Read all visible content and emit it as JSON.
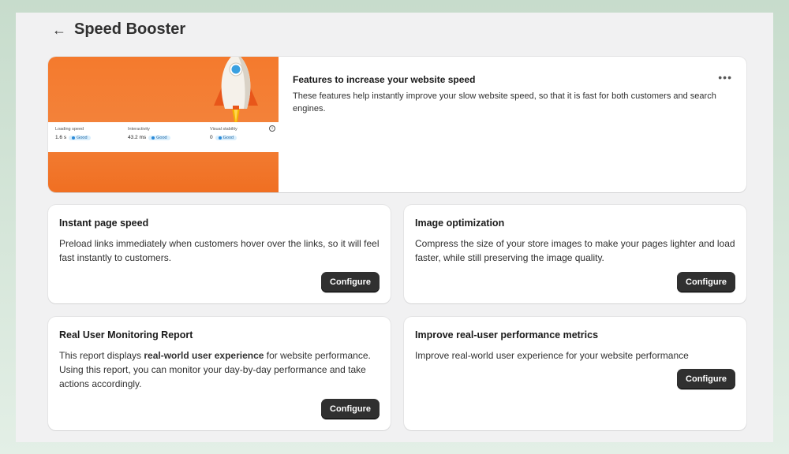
{
  "header": {
    "title": "Speed Booster",
    "back_icon": "←"
  },
  "hero": {
    "title": "Features to increase your website speed",
    "description": "These features help instantly improve your slow website speed, so that it is fast for both customers and search engines.",
    "more_label": "•••",
    "metrics": [
      {
        "label": "Loading speed",
        "value": "1.6 s",
        "status": "Good"
      },
      {
        "label": "Interactivity",
        "value": "43.2 ms",
        "status": "Good"
      },
      {
        "label": "Visual stability",
        "value": "0",
        "status": "Good"
      }
    ],
    "info_icon": "i",
    "colors": {
      "banner": "#f47a2d",
      "rocket_body": "#f5f1ea",
      "window": "#3aa0e0"
    }
  },
  "features": [
    {
      "title": "Instant page speed",
      "description": "Preload links immediately when customers hover over the links, so it will feel fast instantly to customers.",
      "button": "Configure"
    },
    {
      "title": "Image optimization",
      "description": "Compress the size of your store images to make your pages lighter and load faster, while still preserving the image quality.",
      "button": "Configure"
    },
    {
      "title": "Real User Monitoring Report",
      "description_pre": "This report displays ",
      "description_bold": "real-world user experience",
      "description_post": " for website performance. Using this report, you can monitor your day-by-day performance and take actions accordingly.",
      "button": "Configure"
    },
    {
      "title": "Improve real-user performance metrics",
      "description": "Improve real-world user experience for your website performance",
      "button": "Configure"
    }
  ],
  "colors": {
    "primary_button": "#303030",
    "page_bg": "#f1f1f2"
  }
}
